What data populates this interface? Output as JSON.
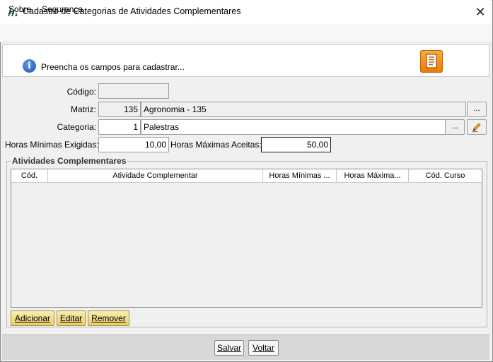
{
  "window": {
    "title": "Cadastro de Categorias de Atividades Complementares",
    "close_glyph": "✕"
  },
  "menu": [
    {
      "label": "Sobre",
      "accel": "S"
    },
    {
      "label": "Segurança"
    }
  ],
  "banner": {
    "message": "Preencha os campos para cadastrar..."
  },
  "form": {
    "codigo": {
      "label": "Código:",
      "value": ""
    },
    "matriz": {
      "label": "Matriz:",
      "code": "135",
      "description": "Agronomia - 135",
      "lookup_label": "..."
    },
    "categoria": {
      "label": "Categoria:",
      "code": "1",
      "description": "Palestras",
      "lookup_label": "..."
    },
    "horas_minimas": {
      "label": "Horas Mínimas Exigidas:",
      "value": "10,00"
    },
    "horas_maximas": {
      "label": "Horas Máximas Aceitas:",
      "value": "50,00"
    }
  },
  "atividades": {
    "title": "Atividades Complementares",
    "columns": [
      "Cód.",
      "Atividade Complementar",
      "Horas Mínimas ...",
      "Horas Máxima...",
      "Cód. Curso"
    ],
    "rows": [],
    "buttons": {
      "adicionar": "Adicionar",
      "editar": "Editar",
      "remover": "Remover"
    }
  },
  "footer": {
    "salvar": "Salvar",
    "voltar": "Voltar"
  },
  "colors": {
    "accent_orange": "#f08a12",
    "info_blue": "#2a62c2",
    "action_yellow": "#f0dc8c"
  }
}
